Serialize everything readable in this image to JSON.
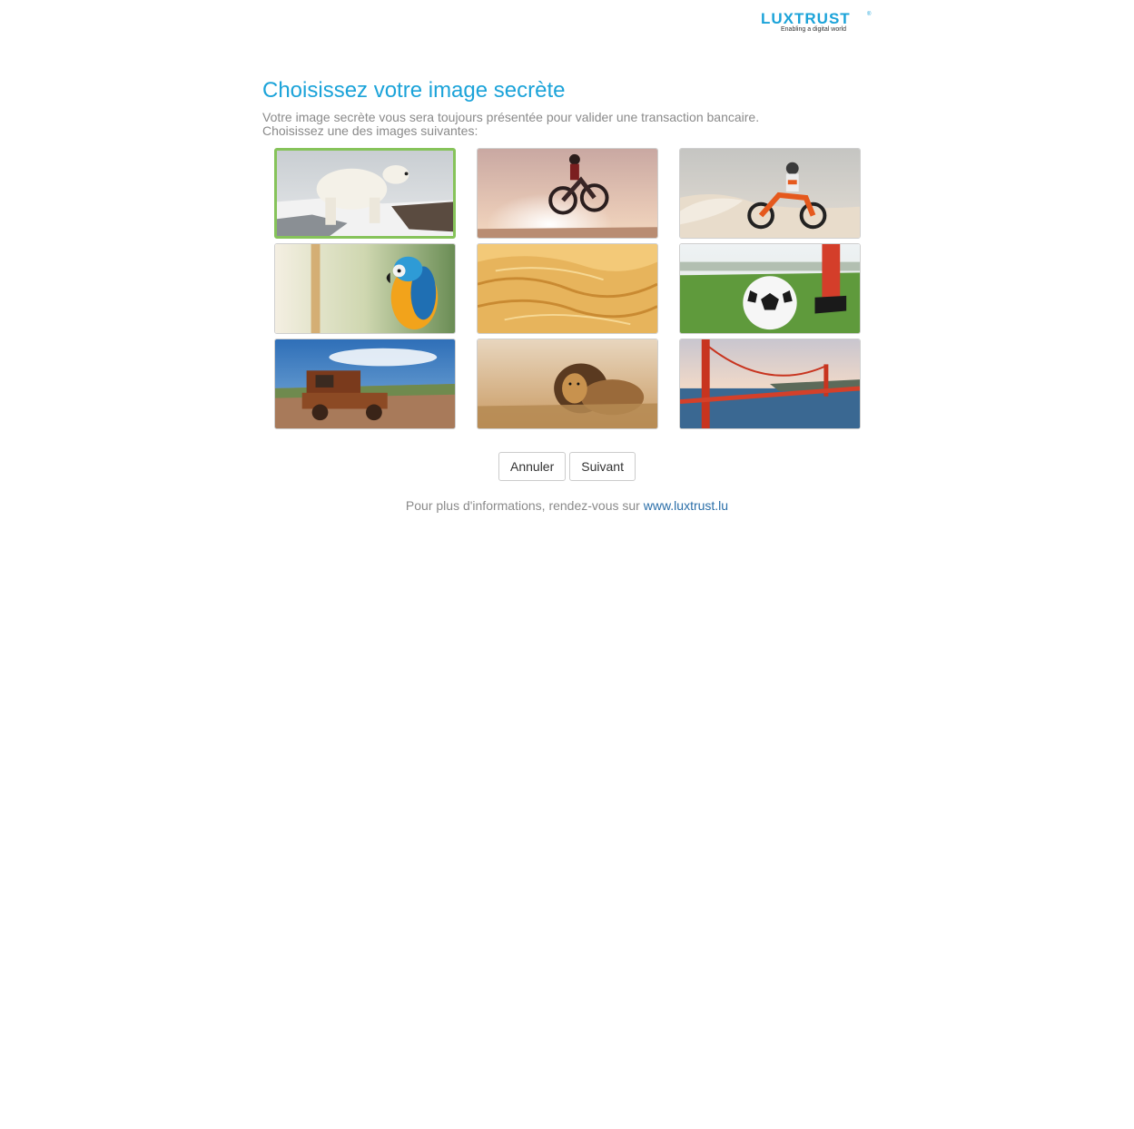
{
  "logo": {
    "brand": "LUXTRUST",
    "registered": "®",
    "tagline": "Enabling a digital world",
    "color": "#1ba3d9"
  },
  "heading": {
    "title": "Choisissez votre image secrète",
    "line1": "Votre image secrète vous sera toujours présentée pour valider une transaction bancaire.",
    "line2": "Choisissez une des images suivantes:"
  },
  "images": [
    {
      "subject": "polar-bear",
      "selected": true
    },
    {
      "subject": "motocross-jump-sunset",
      "selected": false
    },
    {
      "subject": "motocross-sand",
      "selected": false
    },
    {
      "subject": "parrot",
      "selected": false
    },
    {
      "subject": "desert-dunes",
      "selected": false
    },
    {
      "subject": "soccer-ball",
      "selected": false
    },
    {
      "subject": "rusty-car",
      "selected": false
    },
    {
      "subject": "lion",
      "selected": false
    },
    {
      "subject": "golden-gate-bridge",
      "selected": false
    }
  ],
  "buttons": {
    "cancel": "Annuler",
    "next": "Suivant"
  },
  "footer": {
    "text": "Pour plus d'informations, rendez-vous sur ",
    "link": "www.luxtrust.lu"
  },
  "colors": {
    "accent": "#1ba3d9",
    "selected_border": "#86c35a",
    "link": "#2a6ea8"
  }
}
